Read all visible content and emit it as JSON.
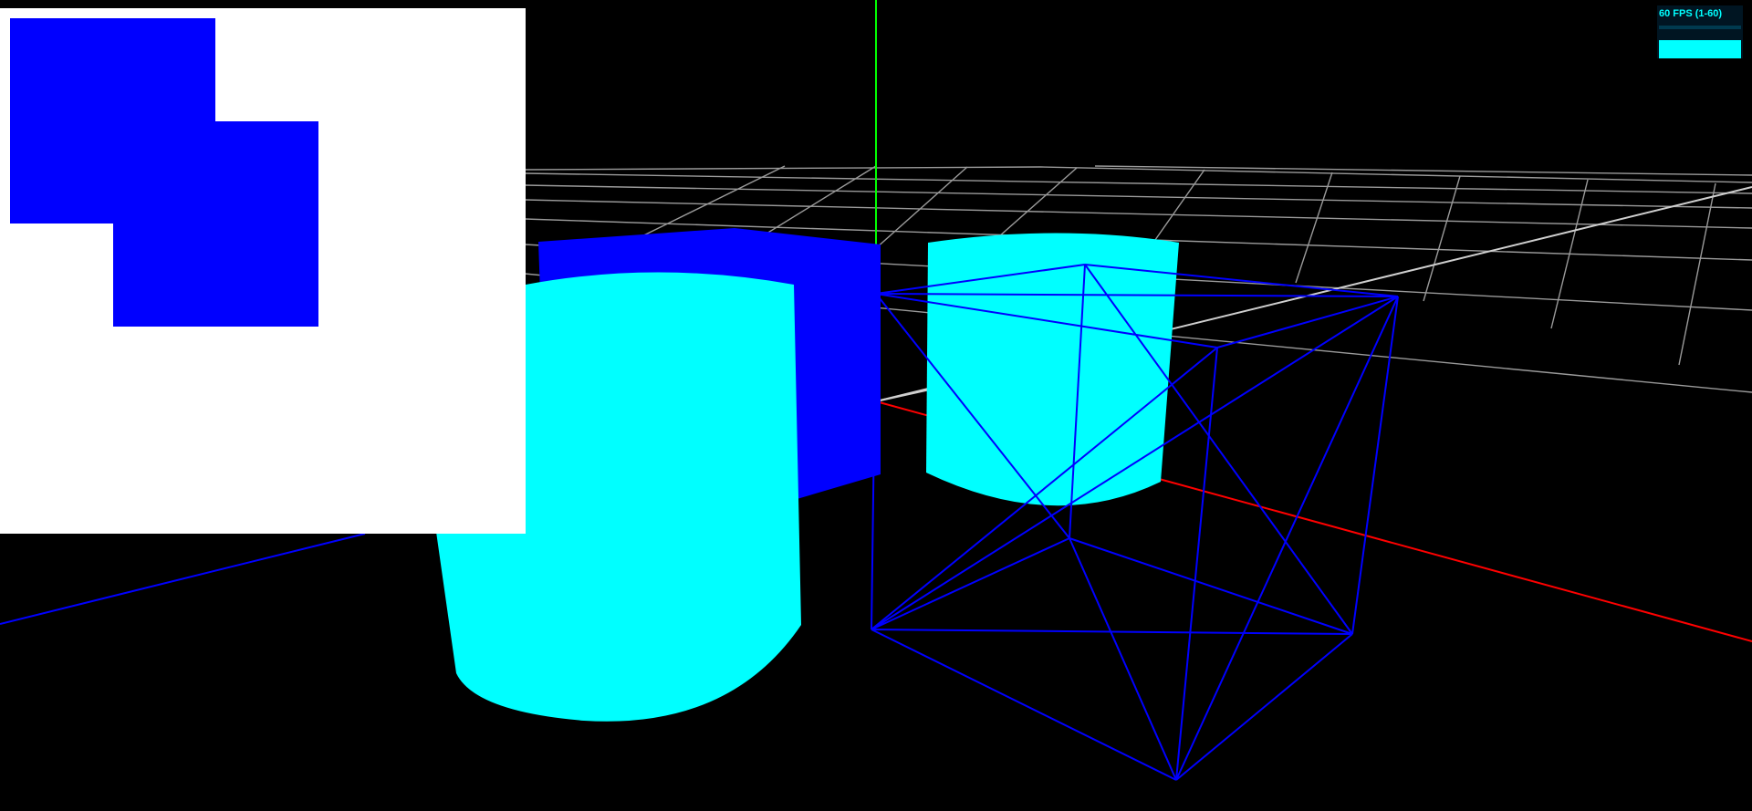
{
  "stats": {
    "fps_label": "60 FPS (1-60)",
    "fps_value": 60,
    "fps_min": 1,
    "fps_max": 60
  },
  "scene": {
    "background_color": "#000000",
    "grid_color": "#9a9a9a",
    "axis_x_color": "#ff0000",
    "axis_y_color": "#00ff00",
    "axis_z_color": "#0000ff",
    "objects": [
      {
        "name": "cube-solid",
        "type": "box",
        "material": "solid",
        "color": "#0000ff"
      },
      {
        "name": "cylinder-front",
        "type": "cylinder",
        "material": "solid",
        "color": "#00ffff"
      },
      {
        "name": "cylinder-back",
        "type": "cylinder",
        "material": "solid",
        "color": "#00ffff"
      },
      {
        "name": "cube-wireframe",
        "type": "box",
        "material": "wireframe",
        "color": "#0000ff"
      }
    ]
  },
  "overlay": {
    "background_color": "#ffffff",
    "block_color": "#0000ff",
    "block_count": 2
  },
  "fps_panel": {
    "background_color": "#001522",
    "text_color": "#00ffff",
    "graph_color": "#00ffff"
  }
}
